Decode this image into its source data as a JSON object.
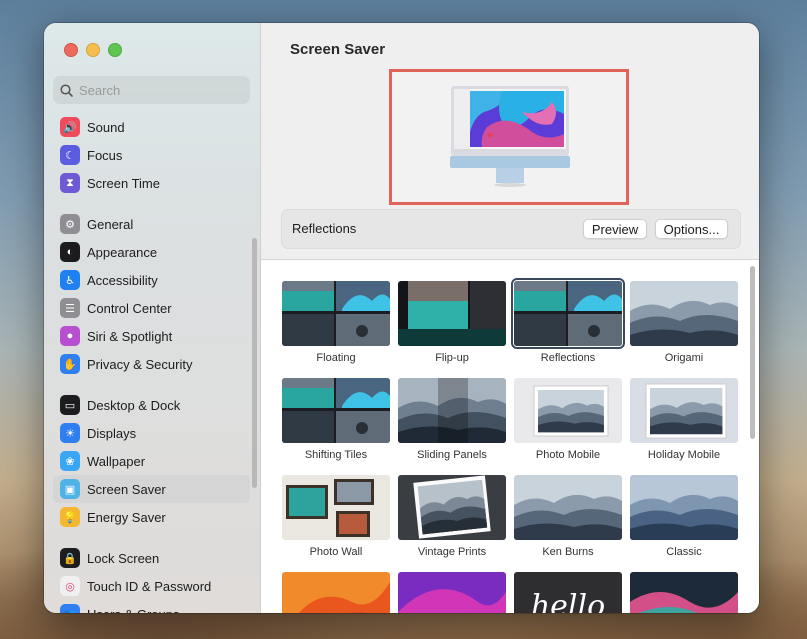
{
  "window": {
    "search_placeholder": "Search",
    "sidebar": {
      "groups": [
        [
          {
            "label": "Sound",
            "icon": "speaker-icon",
            "color": "#ef4b5c"
          },
          {
            "label": "Focus",
            "icon": "moon-icon",
            "color": "#5c5ce0"
          },
          {
            "label": "Screen Time",
            "icon": "hourglass-icon",
            "color": "#6e5bd4"
          }
        ],
        [
          {
            "label": "General",
            "icon": "gear-icon",
            "color": "#8e8e93"
          },
          {
            "label": "Appearance",
            "icon": "appearance-icon",
            "color": "#1c1c1e"
          },
          {
            "label": "Accessibility",
            "icon": "accessibility-icon",
            "color": "#1f80f0"
          },
          {
            "label": "Control Center",
            "icon": "control-center-icon",
            "color": "#8e8e93"
          },
          {
            "label": "Siri & Spotlight",
            "icon": "siri-icon",
            "color": "#b84fd1"
          },
          {
            "label": "Privacy & Security",
            "icon": "hand-icon",
            "color": "#2f7ff0"
          }
        ],
        [
          {
            "label": "Desktop & Dock",
            "icon": "dock-icon",
            "color": "#1c1c1e"
          },
          {
            "label": "Displays",
            "icon": "sun-icon",
            "color": "#2f7ff0"
          },
          {
            "label": "Wallpaper",
            "icon": "flower-icon",
            "color": "#39a7f5"
          },
          {
            "label": "Screen Saver",
            "icon": "screen-saver-icon",
            "color": "#4fb3e6",
            "active": true
          },
          {
            "label": "Energy Saver",
            "icon": "bulb-icon",
            "color": "#f5b731"
          }
        ],
        [
          {
            "label": "Lock Screen",
            "icon": "lock-icon",
            "color": "#1c1c1e"
          },
          {
            "label": "Touch ID & Password",
            "icon": "fingerprint-icon",
            "color": "#f0f0f0"
          },
          {
            "label": "Users & Groups",
            "icon": "users-icon",
            "color": "#2f7ff0"
          }
        ]
      ]
    },
    "main": {
      "title": "Screen Saver",
      "selected_name": "Reflections",
      "preview_label": "Preview",
      "options_label": "Options...",
      "savers": [
        {
          "label": "Floating",
          "style": "mosaic-teal"
        },
        {
          "label": "Flip-up",
          "style": "teal-dark"
        },
        {
          "label": "Reflections",
          "style": "mosaic-teal",
          "selected": true
        },
        {
          "label": "Origami",
          "style": "mountains"
        },
        {
          "label": "Shifting Tiles",
          "style": "mosaic-teal"
        },
        {
          "label": "Sliding Panels",
          "style": "mountains-dark"
        },
        {
          "label": "Photo Mobile",
          "style": "framed-mountain"
        },
        {
          "label": "Holiday Mobile",
          "style": "framed-mountain-light"
        },
        {
          "label": "Photo Wall",
          "style": "photo-wall"
        },
        {
          "label": "Vintage Prints",
          "style": "vintage"
        },
        {
          "label": "Ken Burns",
          "style": "mountains"
        },
        {
          "label": "Classic",
          "style": "mountains-blue"
        },
        {
          "label": "",
          "style": "ventura"
        },
        {
          "label": "",
          "style": "monterey"
        },
        {
          "label": "",
          "style": "hello"
        },
        {
          "label": "",
          "style": "colorful-waves"
        }
      ]
    }
  }
}
